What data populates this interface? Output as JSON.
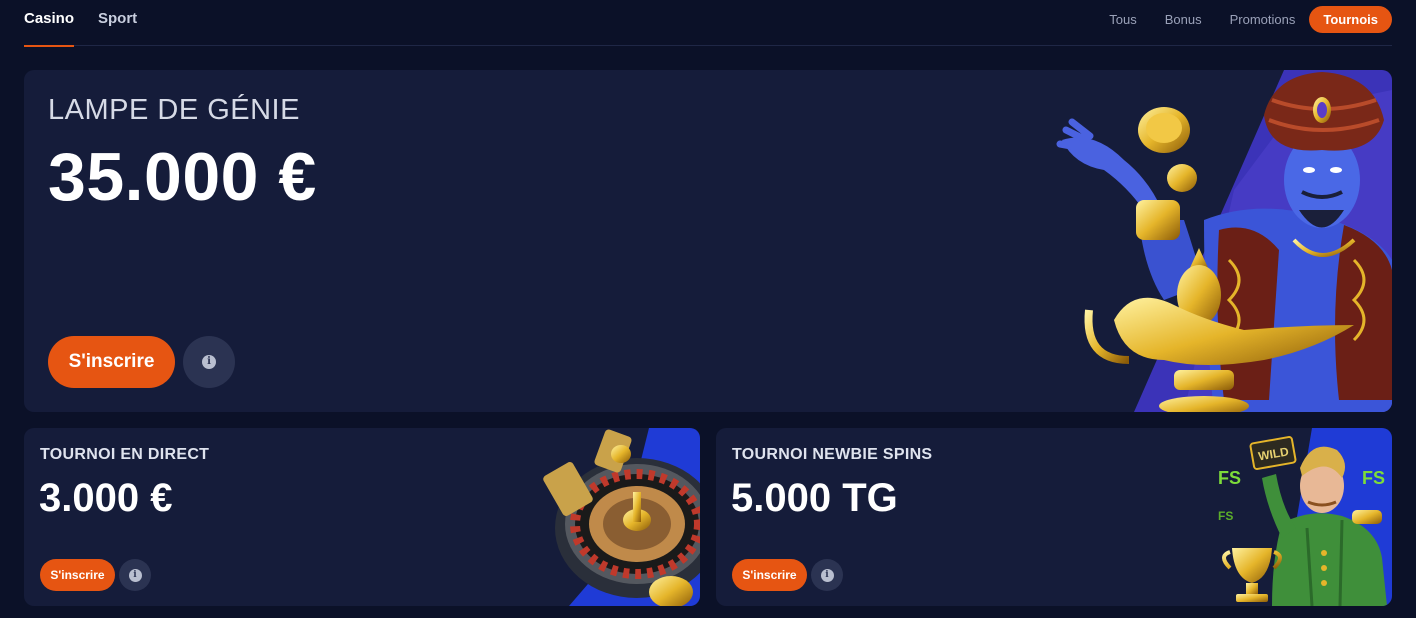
{
  "nav": {
    "tabs": [
      {
        "label": "Casino",
        "active": true
      },
      {
        "label": "Sport",
        "active": false
      }
    ],
    "filters": [
      {
        "label": "Tous",
        "active": false
      },
      {
        "label": "Bonus",
        "active": false
      },
      {
        "label": "Promotions",
        "active": false
      },
      {
        "label": "Tournois",
        "active": true
      }
    ]
  },
  "hero": {
    "label": "LAMPE DE GÉNIE",
    "amount": "35.000 €",
    "register_label": "S'inscrire",
    "info_icon": "i"
  },
  "tournaments": [
    {
      "label": "TOURNOI EN DIRECT",
      "amount": "3.000 €",
      "register_label": "S'inscrire",
      "info_icon": "i"
    },
    {
      "label": "TOURNOI NEWBIE SPINS",
      "amount": "5.000 TG",
      "register_label": "S'inscrire",
      "info_icon": "i"
    }
  ],
  "art": {
    "wild_label": "WILD",
    "fs_label": "FS"
  },
  "colors": {
    "background": "#0b1128",
    "card": "#151c3a",
    "accent": "#e65512",
    "art_blue": "#2a3bd6"
  }
}
